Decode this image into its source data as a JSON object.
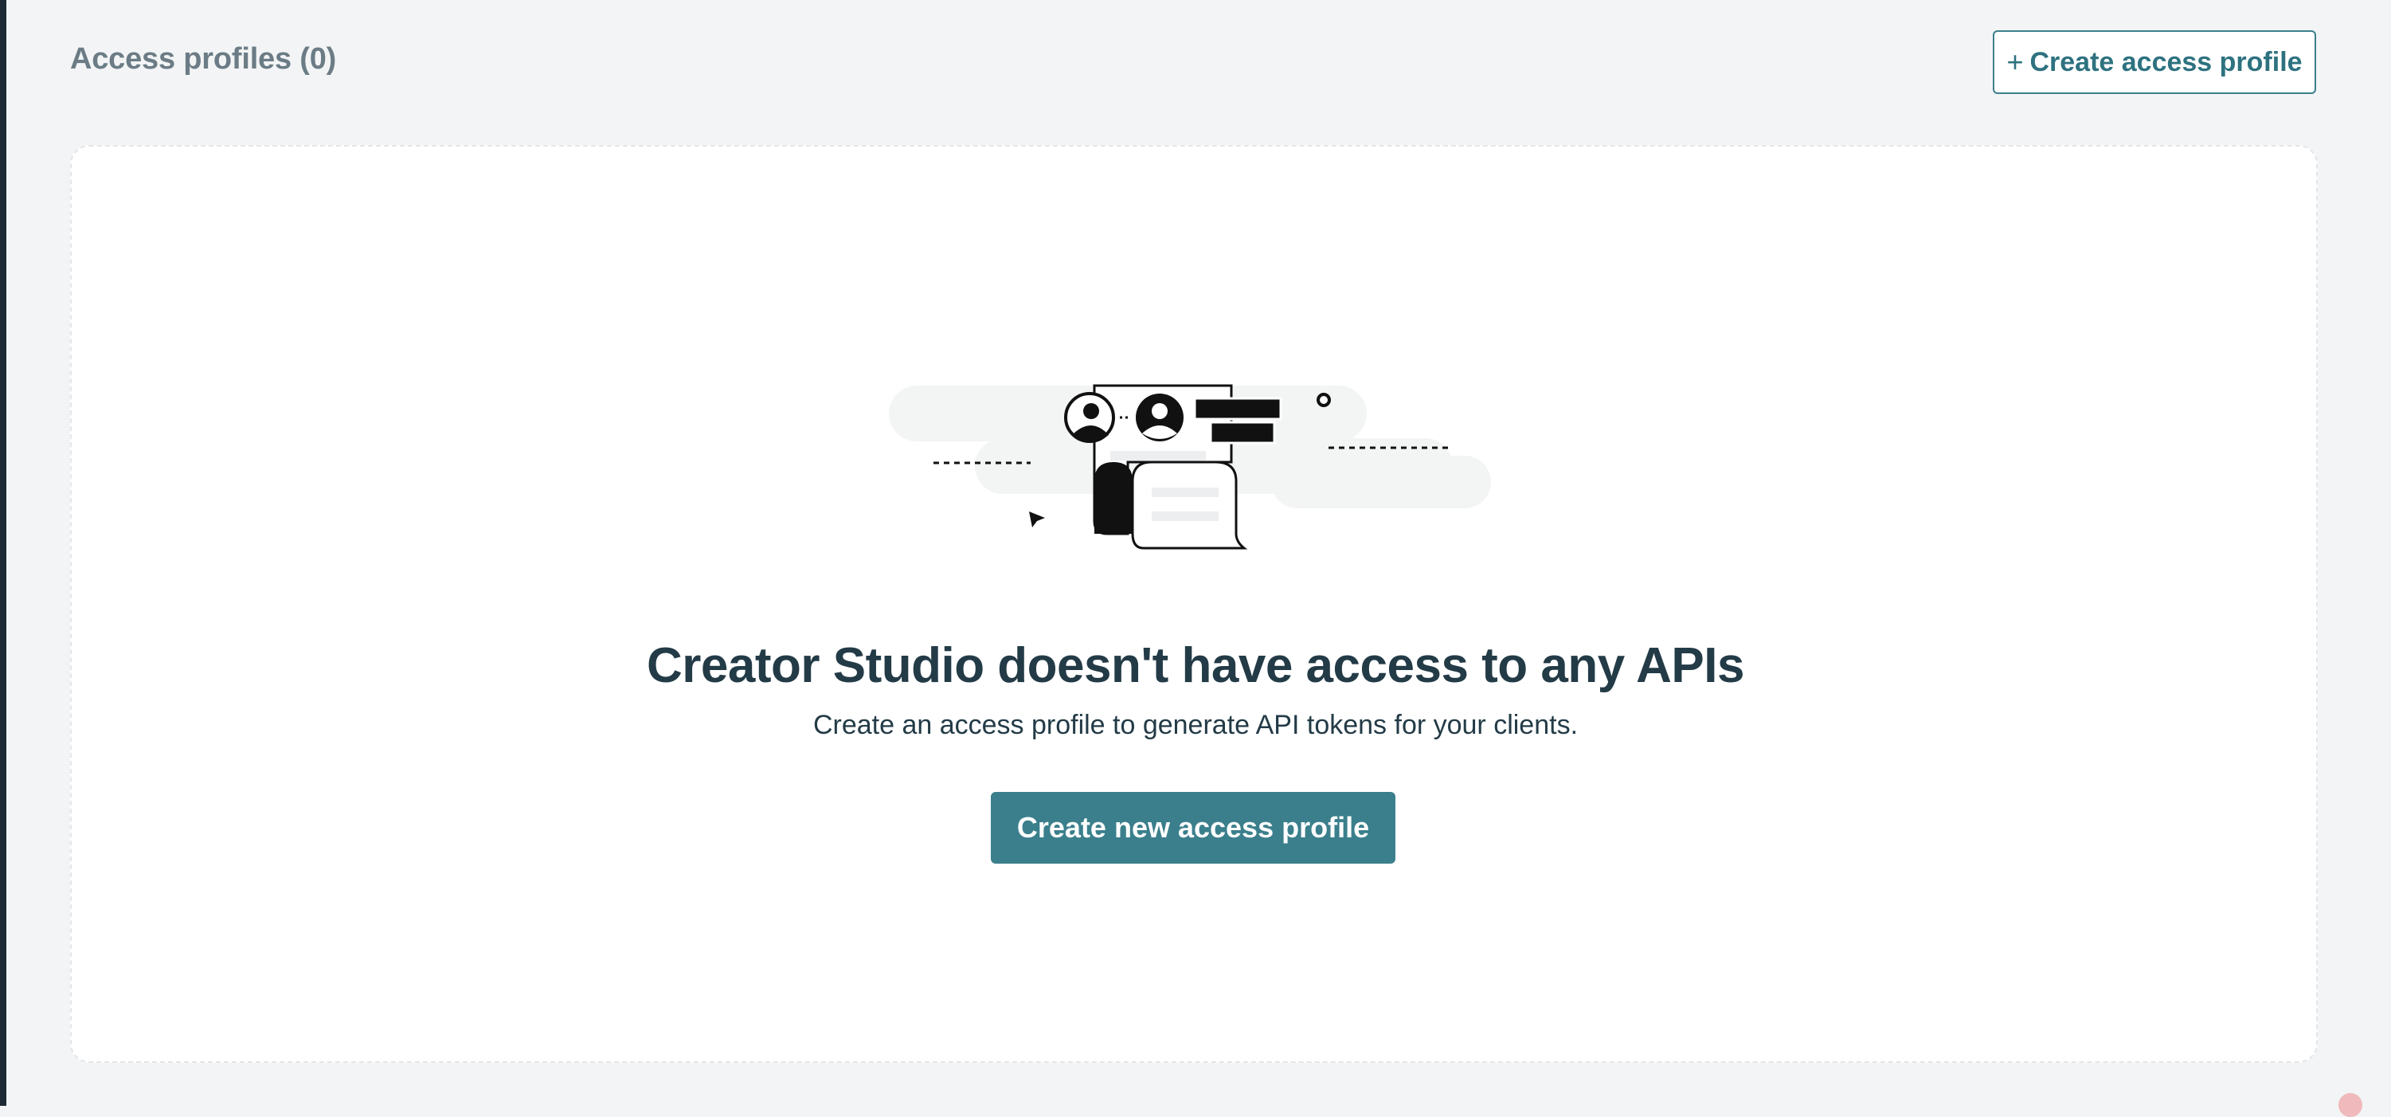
{
  "header": {
    "title": "Access profiles (0)",
    "create_button": {
      "plus": "+",
      "label": "Create access profile"
    }
  },
  "empty_state": {
    "illustration": "access-profile-illustration",
    "title": "Creator Studio doesn't have access to any APIs",
    "subtitle": "Create an access profile to generate API tokens for your clients.",
    "primary_button": "Create new access profile"
  },
  "colors": {
    "accent": "#3b7f8c",
    "title_text": "#233b47",
    "muted_text": "#6b7c86",
    "background": "#f3f4f5"
  }
}
